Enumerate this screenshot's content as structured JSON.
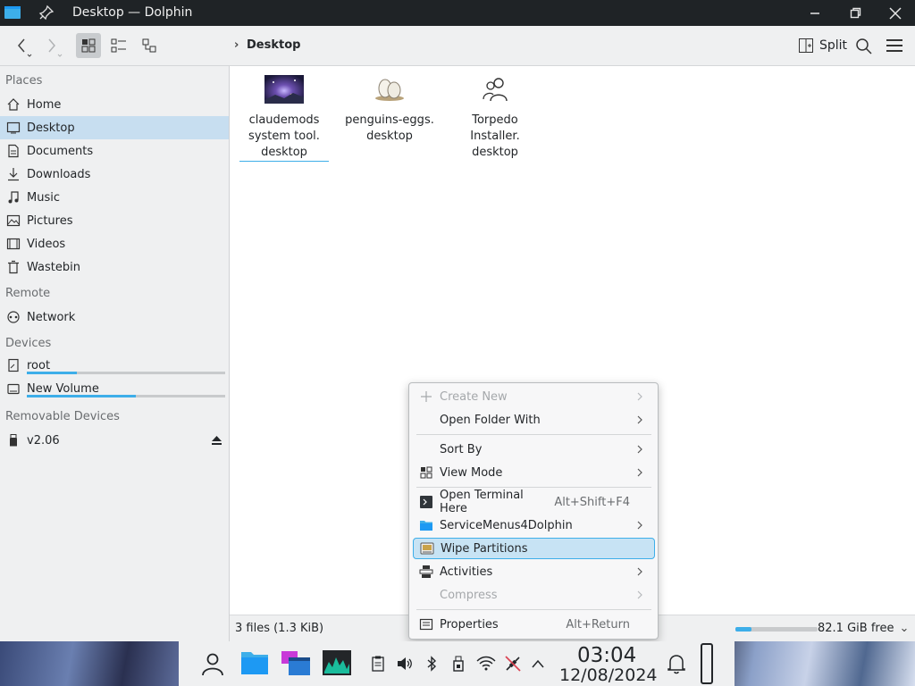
{
  "window": {
    "title": "Desktop — Dolphin"
  },
  "toolbar": {
    "breadcrumb": "Desktop",
    "split_label": "Split"
  },
  "sidebar": {
    "places_header": "Places",
    "places": [
      {
        "label": "Home",
        "icon": "home-icon"
      },
      {
        "label": "Desktop",
        "icon": "desktop-icon",
        "selected": true
      },
      {
        "label": "Documents",
        "icon": "documents-icon"
      },
      {
        "label": "Downloads",
        "icon": "downloads-icon"
      },
      {
        "label": "Music",
        "icon": "music-icon"
      },
      {
        "label": "Pictures",
        "icon": "pictures-icon"
      },
      {
        "label": "Videos",
        "icon": "videos-icon"
      },
      {
        "label": "Wastebin",
        "icon": "wastebin-icon"
      }
    ],
    "remote_header": "Remote",
    "remote": [
      {
        "label": "Network",
        "icon": "network-icon"
      }
    ],
    "devices_header": "Devices",
    "devices": [
      {
        "label": "root",
        "icon": "drive-icon",
        "usage": 0.25
      },
      {
        "label": "New Volume",
        "icon": "drive-icon",
        "usage": 0.55
      }
    ],
    "removable_header": "Removable Devices",
    "removable": [
      {
        "label": "v2.06",
        "icon": "usb-icon"
      }
    ]
  },
  "files": [
    {
      "name_lines": [
        "claudemods",
        "system tool.",
        "desktop"
      ],
      "icon": "image-thumbnail",
      "selected": true
    },
    {
      "name_lines": [
        "penguins-eggs.",
        "desktop"
      ],
      "icon": "eggs-icon"
    },
    {
      "name_lines": [
        "Torpedo Installer.",
        "desktop"
      ],
      "icon": "users-icon"
    }
  ],
  "statusbar": {
    "summary": "3 files (1.3 KiB)",
    "free": "82.1 GiB free",
    "used_fraction": 0.2
  },
  "context_menu": {
    "items": [
      {
        "label": "Create New",
        "disabled": true,
        "submenu": true,
        "icon": "plus-icon"
      },
      {
        "label": "Open Folder With",
        "submenu": true
      },
      {
        "label": "Sort By",
        "submenu": true
      },
      {
        "label": "View Mode",
        "submenu": true,
        "icon": "view-mode-icon"
      },
      {
        "label": "Open Terminal Here",
        "shortcut": "Alt+Shift+F4",
        "icon": "terminal-icon"
      },
      {
        "label": "ServiceMenus4Dolphin",
        "submenu": true,
        "icon": "folder-icon"
      },
      {
        "label": "Wipe Partitions",
        "highlighted": true,
        "icon": "wipe-icon"
      },
      {
        "label": "Activities",
        "submenu": true,
        "icon": "activities-icon"
      },
      {
        "label": "Compress",
        "disabled": true,
        "submenu": true
      },
      {
        "label": "Properties",
        "shortcut": "Alt+Return",
        "icon": "properties-icon"
      }
    ]
  },
  "taskbar": {
    "time": "03:04",
    "date": "12/08/2024"
  },
  "colors": {
    "accent": "#3daee9",
    "selection": "#c7def0",
    "titlebar": "#1f2326"
  }
}
